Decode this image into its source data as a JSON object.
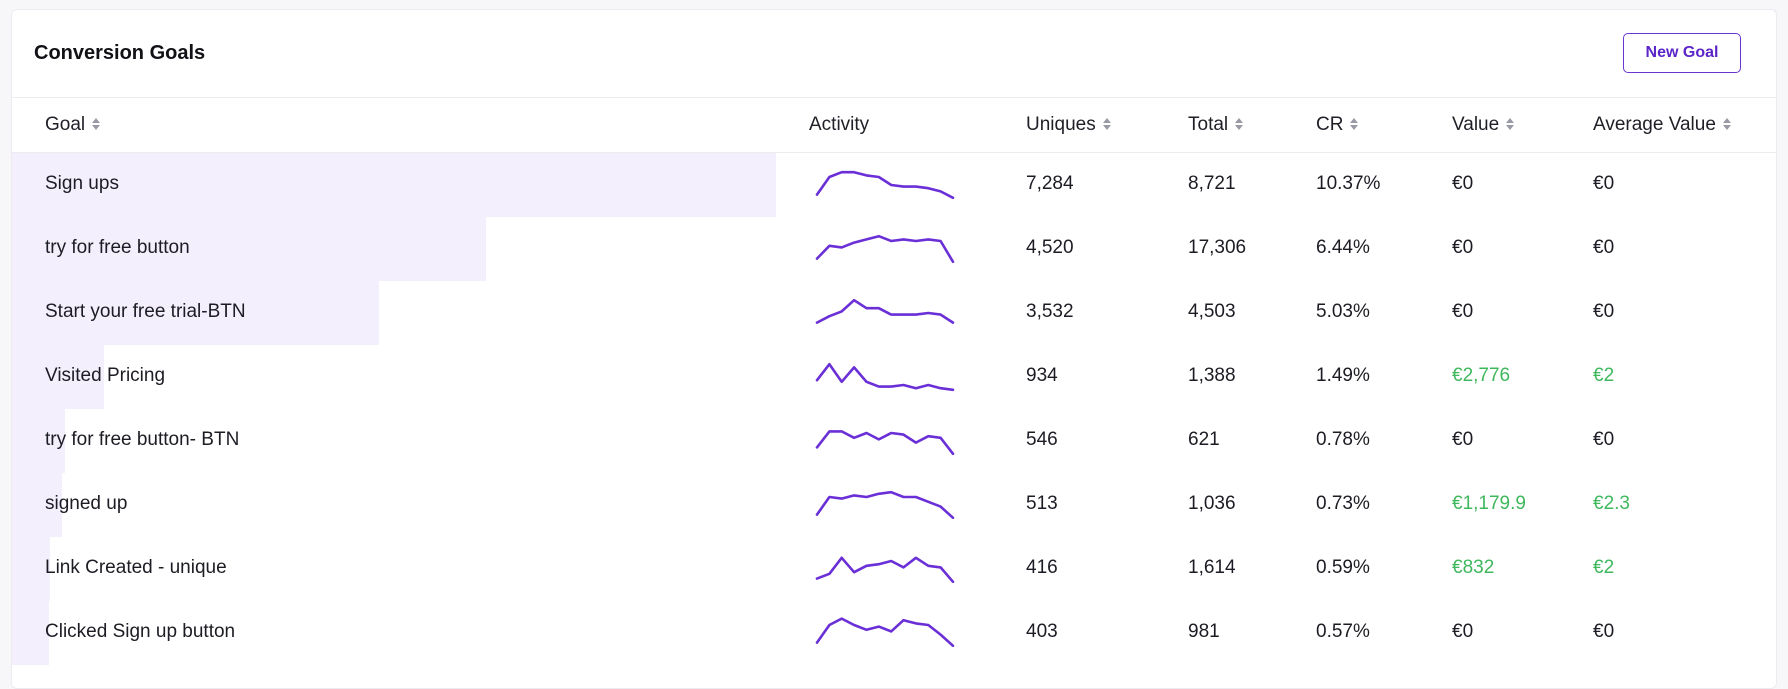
{
  "title": "Conversion Goals",
  "new_goal_label": "New Goal",
  "accent_color": "#6b35d6",
  "positive_value_color": "#3fb85d",
  "columns": {
    "goal": "Goal",
    "activity": "Activity",
    "uniques": "Uniques",
    "total": "Total",
    "cr": "CR",
    "value": "Value",
    "avg_value": "Average Value"
  },
  "rows": [
    {
      "goal": "Sign ups",
      "uniques": "7,284",
      "total": "8,721",
      "cr": "10.37%",
      "value": "€0",
      "avg_value": "€0",
      "share": 1.0,
      "spark": [
        0.2,
        0.75,
        0.9,
        0.9,
        0.8,
        0.75,
        0.5,
        0.45,
        0.45,
        0.4,
        0.3,
        0.1
      ]
    },
    {
      "goal": "try for free button",
      "uniques": "4,520",
      "total": "17,306",
      "cr": "6.44%",
      "value": "€0",
      "avg_value": "€0",
      "share": 0.62,
      "spark": [
        0.2,
        0.6,
        0.55,
        0.7,
        0.8,
        0.9,
        0.75,
        0.8,
        0.75,
        0.8,
        0.75,
        0.1
      ]
    },
    {
      "goal": "Start your free trial-BTN",
      "uniques": "3,532",
      "total": "4,503",
      "cr": "5.03%",
      "value": "€0",
      "avg_value": "€0",
      "share": 0.48,
      "spark": [
        0.2,
        0.4,
        0.55,
        0.9,
        0.65,
        0.65,
        0.45,
        0.45,
        0.45,
        0.5,
        0.45,
        0.2
      ]
    },
    {
      "goal": "Visited Pricing",
      "uniques": "934",
      "total": "1,388",
      "cr": "1.49%",
      "value": "€2,776",
      "avg_value": "€2",
      "share": 0.12,
      "spark": [
        0.4,
        0.9,
        0.35,
        0.8,
        0.35,
        0.2,
        0.2,
        0.25,
        0.15,
        0.25,
        0.15,
        0.1
      ]
    },
    {
      "goal": "try for free button- BTN",
      "uniques": "546",
      "total": "621",
      "cr": "0.78%",
      "value": "€0",
      "avg_value": "€0",
      "share": 0.07,
      "spark": [
        0.3,
        0.8,
        0.8,
        0.6,
        0.75,
        0.55,
        0.75,
        0.7,
        0.45,
        0.65,
        0.6,
        0.1
      ]
    },
    {
      "goal": "signed up",
      "uniques": "513",
      "total": "1,036",
      "cr": "0.73%",
      "value": "€1,179.9",
      "avg_value": "€2.3",
      "share": 0.066,
      "spark": [
        0.2,
        0.75,
        0.7,
        0.8,
        0.75,
        0.85,
        0.9,
        0.75,
        0.75,
        0.6,
        0.45,
        0.1
      ]
    },
    {
      "goal": "Link Created - unique",
      "uniques": "416",
      "total": "1,614",
      "cr": "0.59%",
      "value": "€832",
      "avg_value": "€2",
      "share": 0.05,
      "spark": [
        0.2,
        0.35,
        0.85,
        0.4,
        0.6,
        0.65,
        0.75,
        0.55,
        0.85,
        0.6,
        0.55,
        0.1
      ]
    },
    {
      "goal": "Clicked Sign up button",
      "uniques": "403",
      "total": "981",
      "cr": "0.57%",
      "value": "€0",
      "avg_value": "€0",
      "share": 0.048,
      "spark": [
        0.2,
        0.75,
        0.95,
        0.75,
        0.6,
        0.7,
        0.55,
        0.9,
        0.8,
        0.75,
        0.45,
        0.1
      ]
    }
  ]
}
